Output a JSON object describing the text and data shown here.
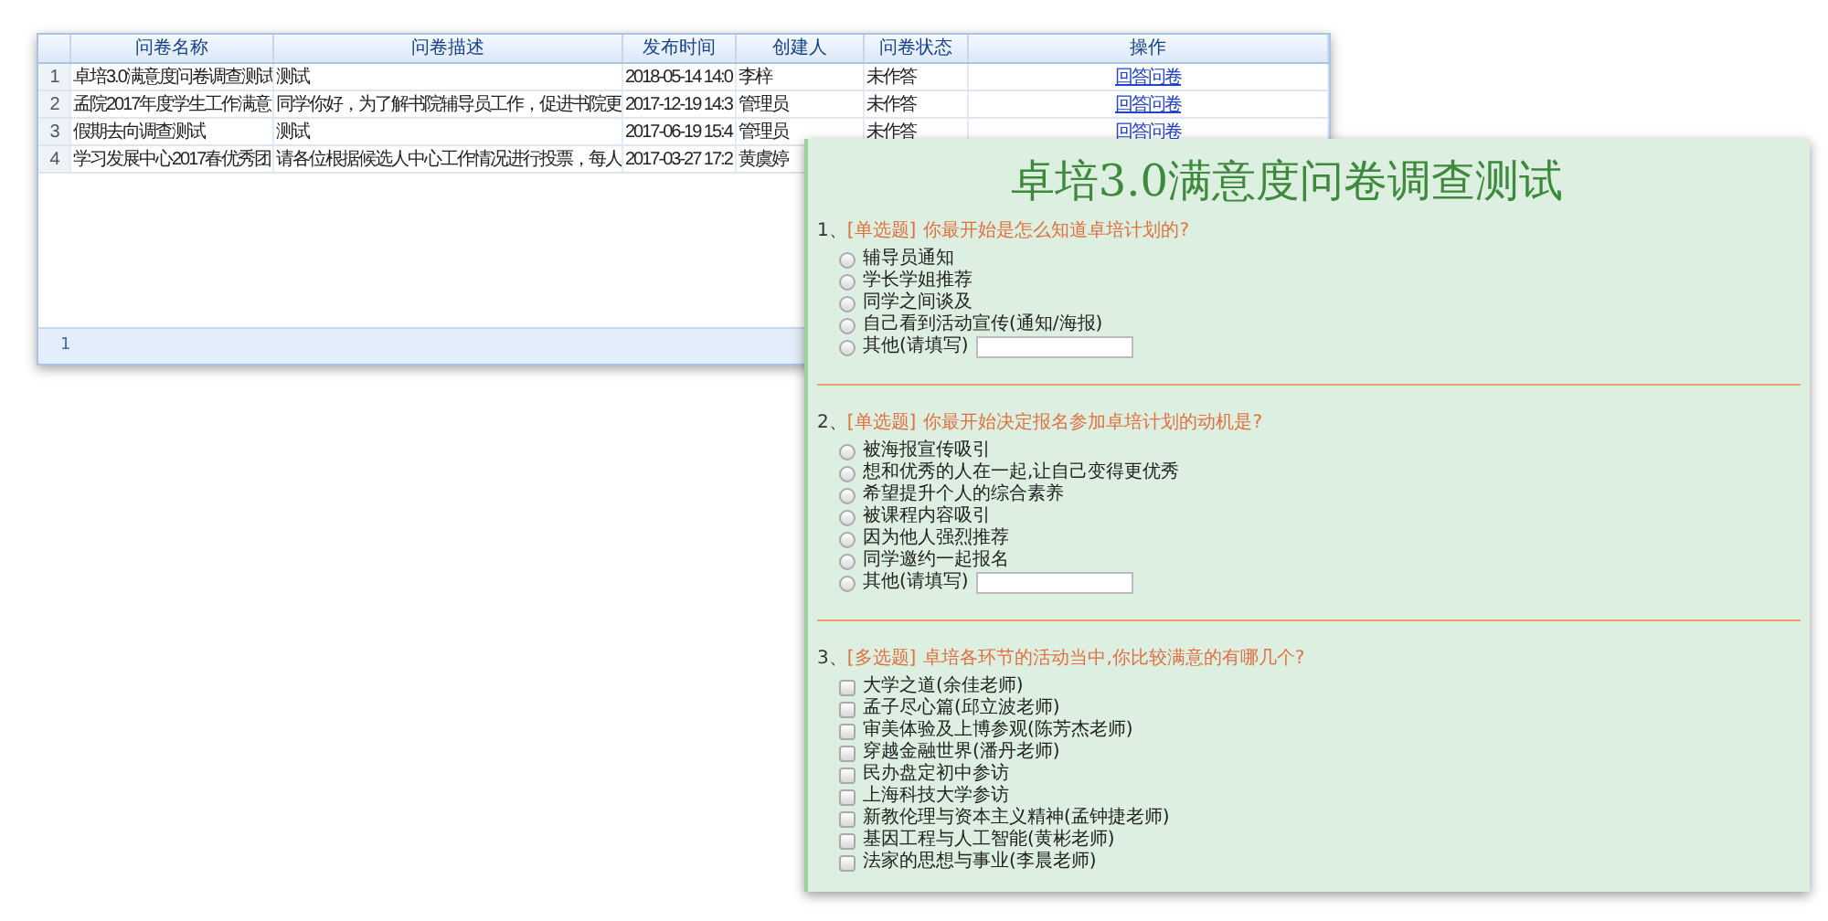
{
  "table": {
    "columns": [
      "问卷名称",
      "问卷描述",
      "发布时间",
      "创建人",
      "问卷状态",
      "操作"
    ],
    "rows": [
      {
        "number": "1",
        "name": "卓培3.0满意度问卷调查测试",
        "description": "测试",
        "published": "2018-05-14 14:0",
        "creator": "李梓",
        "status": "未作答",
        "action": "回答问卷"
      },
      {
        "number": "2",
        "name": "孟院2017年度学生工作满意",
        "description": "同学你好，为了解书院辅导员工作，促进书院更",
        "published": "2017-12-19 14:3",
        "creator": "管理员",
        "status": "未作答",
        "action": "回答问卷"
      },
      {
        "number": "3",
        "name": "假期去向调查测试",
        "description": "测试",
        "published": "2017-06-19 15:4",
        "creator": "管理员",
        "status": "未作答",
        "action": "回答问卷"
      },
      {
        "number": "4",
        "name": "学习发展中心2017春优秀团",
        "description": "请各位根据候选人中心工作情况进行投票，每人",
        "published": "2017-03-27 17:2",
        "creator": "黄虞婷"
      }
    ],
    "pager": {
      "page": "1"
    }
  },
  "survey": {
    "title": "卓培3.0满意度问卷调查测试",
    "questions": [
      {
        "number": "1、",
        "type": "[单选题]",
        "text": "你最开始是怎么知道卓培计划的?",
        "kind": "radio",
        "options": [
          {
            "label": "辅导员通知",
            "kind": "option",
            "checked": false
          },
          {
            "label": "学长学姐推荐",
            "kind": "option",
            "checked": false
          },
          {
            "label": "同学之间谈及",
            "kind": "option",
            "checked": false
          },
          {
            "label": "自己看到活动宣传(通知/海报)",
            "kind": "option",
            "checked": false
          },
          {
            "label": "其他(请填写)",
            "kind": "other",
            "checked": false
          }
        ]
      },
      {
        "number": "2、",
        "type": "[单选题]",
        "text": "你最开始决定报名参加卓培计划的动机是?",
        "kind": "radio",
        "options": [
          {
            "label": "被海报宣传吸引",
            "kind": "option",
            "checked": false
          },
          {
            "label": "想和优秀的人在一起,让自己变得更优秀",
            "kind": "option",
            "checked": false
          },
          {
            "label": "希望提升个人的综合素养",
            "kind": "option",
            "checked": false
          },
          {
            "label": "被课程内容吸引",
            "kind": "option",
            "checked": false
          },
          {
            "label": "因为他人强烈推荐",
            "kind": "option",
            "checked": false
          },
          {
            "label": "同学邀约一起报名",
            "kind": "option",
            "checked": false
          },
          {
            "label": "其他(请填写)",
            "kind": "other",
            "checked": false
          }
        ]
      },
      {
        "number": "3、",
        "type": "[多选题]",
        "text": "卓培各环节的活动当中,你比较满意的有哪几个?",
        "kind": "checkbox",
        "options": [
          {
            "label": "大学之道(余佳老师)",
            "kind": "option",
            "checked": false
          },
          {
            "label": "孟子尽心篇(邱立波老师)",
            "kind": "option",
            "checked": false
          },
          {
            "label": "审美体验及上博参观(陈芳杰老师)",
            "kind": "option",
            "checked": false
          },
          {
            "label": "穿越金融世界(潘丹老师)",
            "kind": "option",
            "checked": false
          },
          {
            "label": "民办盘定初中参访",
            "kind": "option",
            "checked": false
          },
          {
            "label": "上海科技大学参访",
            "kind": "option",
            "checked": false
          },
          {
            "label": "新教伦理与资本主义精神(孟钟捷老师)",
            "kind": "option",
            "checked": false
          },
          {
            "label": "基因工程与人工智能(黄彬老师)",
            "kind": "option",
            "checked": false
          },
          {
            "label": "法家的思想与事业(李晨老师)",
            "kind": "option",
            "checked": false
          }
        ]
      }
    ]
  }
}
